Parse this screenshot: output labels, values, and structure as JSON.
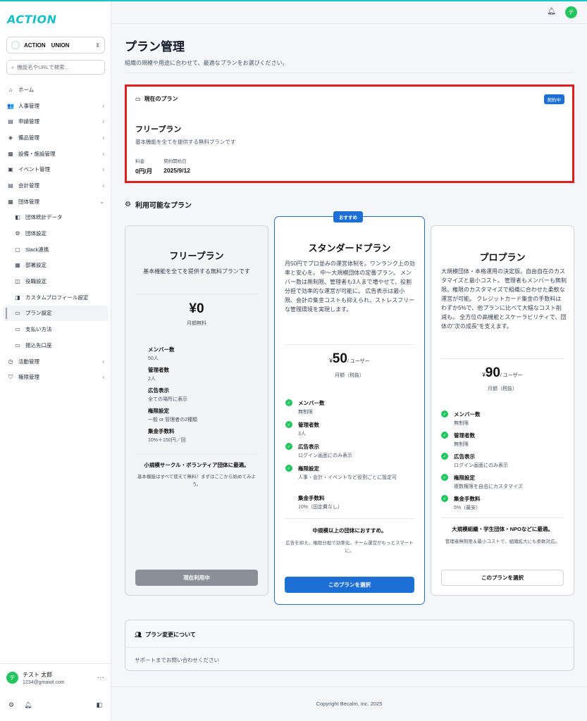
{
  "sidebar": {
    "logo": "ACTION",
    "org_name": "ACTION　UNION",
    "search_placeholder": "機能名やURLで検索...",
    "items": [
      {
        "icon": "⌂",
        "label": "ホーム",
        "arrow": ""
      },
      {
        "icon": "👥",
        "label": "人事管理",
        "arrow": "›"
      },
      {
        "icon": "▤",
        "label": "申請管理",
        "arrow": "›"
      },
      {
        "icon": "◈",
        "label": "備品管理",
        "arrow": "›"
      },
      {
        "icon": "▦",
        "label": "設備・施設管理",
        "arrow": "›"
      },
      {
        "icon": "▣",
        "label": "イベント管理",
        "arrow": "›"
      },
      {
        "icon": "▤",
        "label": "会計管理",
        "arrow": "›"
      },
      {
        "icon": "▦",
        "label": "団体管理",
        "arrow": "⌄"
      }
    ],
    "subitems": [
      {
        "icon": "◧",
        "label": "団体統計データ"
      },
      {
        "icon": "⚙",
        "label": "団体設定"
      },
      {
        "icon": "▢",
        "label": "Slack連携"
      },
      {
        "icon": "▦",
        "label": "部署設定"
      },
      {
        "icon": "◫",
        "label": "役職設定"
      },
      {
        "icon": "◨",
        "label": "カスタムプロフィール設定"
      },
      {
        "icon": "▭",
        "label": "プラン設定"
      },
      {
        "icon": "▭",
        "label": "支払い方法"
      },
      {
        "icon": "▭",
        "label": "振込先口座"
      }
    ],
    "items2": [
      {
        "icon": "◷",
        "label": "活動管理",
        "arrow": "›"
      },
      {
        "icon": "⛉",
        "label": "権限管理",
        "arrow": "›"
      }
    ],
    "user": {
      "avatar": "テ",
      "name": "テスト 太郎",
      "email": "1234@gmaiwl.com"
    }
  },
  "header": {
    "avatar": "テ"
  },
  "page": {
    "title": "プラン管理",
    "subtitle": "組織の規模や用途に合わせて、最適なプランをお選びください。"
  },
  "current": {
    "heading": "現在のプラン",
    "badge": "契約中",
    "name": "フリープラン",
    "desc": "基本機能を全てを提供する無料プランです",
    "fee_label": "料金",
    "fee_value": "0円/月",
    "start_label": "契約開始日",
    "start_value": "2025/9/12"
  },
  "available_title": "利用可能なプラン",
  "plans": {
    "free": {
      "title": "フリープラン",
      "desc": "基本機能を全てを提供する無料プランです",
      "price": "¥0",
      "price_note": "月額無料",
      "features": [
        {
          "label": "メンバー数",
          "value": "50人"
        },
        {
          "label": "管理者数",
          "value": "2人"
        },
        {
          "label": "広告表示",
          "value": "全ての場所に表示"
        },
        {
          "label": "権限設定",
          "value": "一般 or 管理者の2種類"
        },
        {
          "label": "集金手数料",
          "value": "10%＋150円／回"
        }
      ],
      "rec": "小規模サークル・ボランティア団体に最適。",
      "rec_sub": "基本機能はすべて使えて無料！まずはここから始めてみよう。",
      "button": "現在利用中"
    },
    "standard": {
      "badge": "おすすめ",
      "title": "スタンダードプラン",
      "desc": "月50円でプロ並みの運営体制を。ワンランク上の効率と安心を。 中〜大規模団体の定番プラン。 メンバー数は無制限、管理者も3人まで増やせて、役割分担で効率的な運営が可能に。 広告表示は最小限、会計の集金コストも抑えられ、ストレスフリーな管理環境を実現します。",
      "currency": "¥",
      "price": "50",
      "unit": "/ ユーザー",
      "price_note": "月額（税抜）",
      "features": [
        {
          "label": "メンバー数",
          "value": "無制限"
        },
        {
          "label": "管理者数",
          "value": "3人"
        },
        {
          "label": "広告表示",
          "value": "ログイン画面にのみ表示"
        },
        {
          "label": "権限設定",
          "value": "人事・会計・イベントなど役割ごとに設定可"
        },
        {
          "label": "集金手数料",
          "value": "10%（固定費なし）"
        }
      ],
      "rec": "中規模以上の団体におすすめ。",
      "rec_sub": "広告を抑え、権限分担で効率化。チーム運営がもっとスマートに。",
      "button": "このプランを選択"
    },
    "pro": {
      "title": "プロプラン",
      "desc": "大規模団体・本格運用の決定版。自由自在のカスタマイズと最小コスト。 管理者もメンバーも無制限。権限のカスタマイズで組織に合わせた柔軟な運営が可能。 クレジットカード集金の手数料はわずか5%で、他プランに比べて大幅なコスト削減も。 全方位の高機能とスケーラビリティで、団体の\"次の成長\"を支えます。",
      "currency": "¥",
      "price": "90",
      "unit": "/ ユーザー",
      "price_note": "月額（税抜）",
      "features": [
        {
          "label": "メンバー数",
          "value": "無制限"
        },
        {
          "label": "管理者数",
          "value": "無制限"
        },
        {
          "label": "広告表示",
          "value": "ログイン画面にのみ表示"
        },
        {
          "label": "権限設定",
          "value": "複数権限を自由にカスタマイズ"
        },
        {
          "label": "集金手数料",
          "value": "5%（最安）"
        }
      ],
      "rec": "大規模組織・学生団体・NPOなどに最適。",
      "rec_sub": "管理者無制限＆最小コストで、組織拡大にも柔軟対応。",
      "button": "このプランを選択"
    }
  },
  "change": {
    "title": "プラン変更について",
    "text": "サポートまでお問い合わせください"
  },
  "footer": "Copyright Becalm, inc. 2025",
  "colors": {
    "accent": "#1d6fd6",
    "brand": "#16c0c4",
    "highlight": "#e11d1d",
    "success": "#22c55e"
  }
}
